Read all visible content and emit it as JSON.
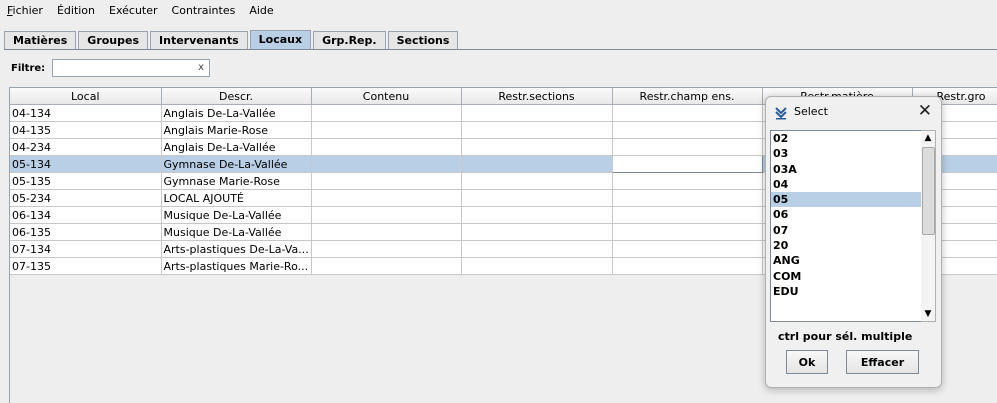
{
  "menu": {
    "items": [
      {
        "first": "F",
        "rest": "ichier"
      },
      {
        "first": "",
        "rest": "Édition"
      },
      {
        "first": "",
        "rest": "Exécuter"
      },
      {
        "first": "",
        "rest": "Contraintes"
      },
      {
        "first": "",
        "rest": "Aide"
      }
    ]
  },
  "tabs": [
    {
      "label": "Matières"
    },
    {
      "label": "Groupes"
    },
    {
      "label": "Intervenants"
    },
    {
      "label": "Locaux",
      "active": true
    },
    {
      "label": "Grp.Rep."
    },
    {
      "label": "Sections"
    }
  ],
  "filter": {
    "label": "Filtre:",
    "value": "",
    "clear": "x"
  },
  "table": {
    "columns": [
      "Local",
      "Descr.",
      "Contenu",
      "Restr.sections",
      "Restr.champ ens.",
      "Restr.matière",
      "Restr.gro"
    ],
    "rows": [
      [
        "04-134",
        "Anglais  De-La-Vallée",
        "",
        "",
        "",
        "",
        ""
      ],
      [
        "04-135",
        "Anglais  Marie-Rose",
        "",
        "",
        "",
        "",
        ""
      ],
      [
        "04-234",
        "Anglais  De-La-Vallée",
        "",
        "",
        "",
        "",
        ""
      ],
      [
        "05-134",
        "Gymnase De-La-Vallée",
        "",
        "",
        "",
        "",
        ""
      ],
      [
        "05-135",
        "Gymnase  Marie-Rose",
        "",
        "",
        "",
        "",
        ""
      ],
      [
        "05-234",
        "LOCAL AJOUTÉ",
        "",
        "",
        "",
        "",
        ""
      ],
      [
        "06-134",
        "Musique De-La-Vallée",
        "",
        "",
        "",
        "",
        ""
      ],
      [
        "06-135",
        "Musique De-La-Vallée",
        "",
        "",
        "",
        "",
        ""
      ],
      [
        "07-134",
        "Arts-plastiques De-La-Va...",
        "",
        "",
        "",
        "",
        ""
      ],
      [
        "07-135",
        "Arts-plastiques  Marie-Ro...",
        "",
        "",
        "",
        "",
        ""
      ]
    ],
    "selected_row": 3
  },
  "dialog": {
    "title": "Select",
    "close": "✕",
    "items": [
      "02",
      "03",
      "03A",
      "04",
      "05",
      "06",
      "07",
      "20",
      "ANG",
      "COM",
      "EDU"
    ],
    "selected_item": "05",
    "hint": "ctrl pour sél. multiple",
    "ok_label": "Ok",
    "clear_label": "Effacer",
    "scroll_up": "▲",
    "scroll_down": "▼"
  }
}
